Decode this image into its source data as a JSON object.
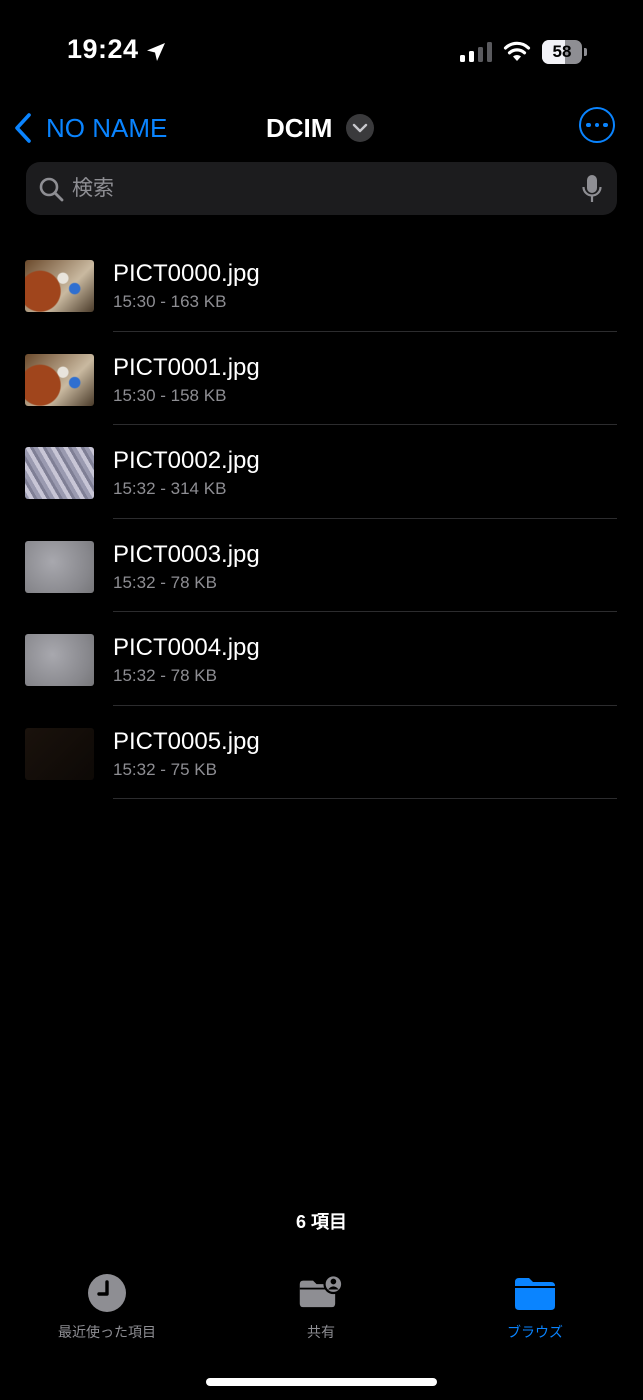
{
  "status": {
    "time": "19:24",
    "battery": "58",
    "battery_fraction": 0.58
  },
  "nav": {
    "back_label": "NO NAME",
    "title": "DCIM"
  },
  "search": {
    "placeholder": "検索"
  },
  "files": [
    {
      "name": "PICT0000.jpg",
      "meta": "15:30 - 163 KB",
      "thumb": "desk-scene"
    },
    {
      "name": "PICT0001.jpg",
      "meta": "15:30 - 158 KB",
      "thumb": "desk-scene"
    },
    {
      "name": "PICT0002.jpg",
      "meta": "15:32 - 314 KB",
      "thumb": "fabric"
    },
    {
      "name": "PICT0003.jpg",
      "meta": "15:32 - 78 KB",
      "thumb": "gray-blur"
    },
    {
      "name": "PICT0004.jpg",
      "meta": "15:32 - 78 KB",
      "thumb": "gray-blur"
    },
    {
      "name": "PICT0005.jpg",
      "meta": "15:32 - 75 KB",
      "thumb": "dark"
    }
  ],
  "item_count": "6 項目",
  "tabs": [
    {
      "label": "最近使った項目",
      "icon": "clock-icon",
      "active": false
    },
    {
      "label": "共有",
      "icon": "shared-folder-icon",
      "active": false
    },
    {
      "label": "ブラウズ",
      "icon": "folder-icon",
      "active": true
    }
  ],
  "colors": {
    "accent": "#0a84ff",
    "background": "#000000",
    "secondary_text": "#8e8e93"
  }
}
